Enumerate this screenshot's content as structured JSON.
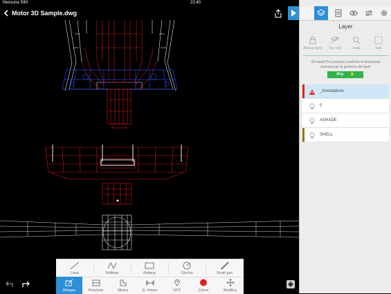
{
  "status": {
    "carrier": "Nessuna SIM",
    "time": "22:40"
  },
  "header": {
    "back_icon": "chevron-left-icon",
    "file_name": "Motor 3D Sample.dwg"
  },
  "panel": {
    "tabs": [
      "layers-icon",
      "properties-icon",
      "visibility-icon",
      "sliders-icon",
      "settings-icon"
    ],
    "active_tab": "layers-icon",
    "title": "Layer",
    "tools": [
      {
        "label": "Blocca layer",
        "icon": "lock-layer-icon"
      },
      {
        "label": "Dis. tutti",
        "icon": "layer-off-icon"
      },
      {
        "label": "Isola",
        "icon": "isolate-icon"
      },
      {
        "label": "Sele",
        "icon": "select-icon"
      }
    ],
    "promo_text": "Gli utenti Pro possono usufruire di documenti avanzati per la gestione dei layer",
    "pro_button": "Pro",
    "layers": [
      {
        "name": "_Annotations",
        "color": "#e02020",
        "active": true
      },
      {
        "name": "0",
        "color": "#ffffff",
        "active": false
      },
      {
        "name": "ASHADE",
        "color": "#ffffff",
        "active": false
      },
      {
        "name": "SHELL",
        "color": "#8b7b16",
        "active": false
      }
    ]
  },
  "draw_tools": [
    {
      "label": "Linea",
      "icon": "line-icon"
    },
    {
      "label": "Polilinea",
      "icon": "polyline-icon"
    },
    {
      "label": "Rettang",
      "icon": "rectangle-icon"
    },
    {
      "label": "Cerchio",
      "icon": "circle-icon"
    },
    {
      "label": "Smart pen",
      "icon": "pen-icon"
    }
  ],
  "modes": [
    {
      "label": "Disegna",
      "icon": "draw-icon",
      "active": true
    },
    {
      "label": "Posizione",
      "icon": "position-icon",
      "active": false
    },
    {
      "label": "Misura",
      "icon": "measure-icon",
      "active": false
    },
    {
      "label": "Q. Viewer",
      "icon": "quick-viewer-icon",
      "active": false
    },
    {
      "label": "GPS",
      "icon": "gps-icon",
      "active": false
    },
    {
      "label": "Colore",
      "icon": "color-icon",
      "active": false
    },
    {
      "label": "Modifica",
      "icon": "modify-icon",
      "active": false
    }
  ],
  "colors": {
    "accent": "#2d8fd6",
    "pro_green": "#2fb34a",
    "active_color": "#e02020"
  }
}
